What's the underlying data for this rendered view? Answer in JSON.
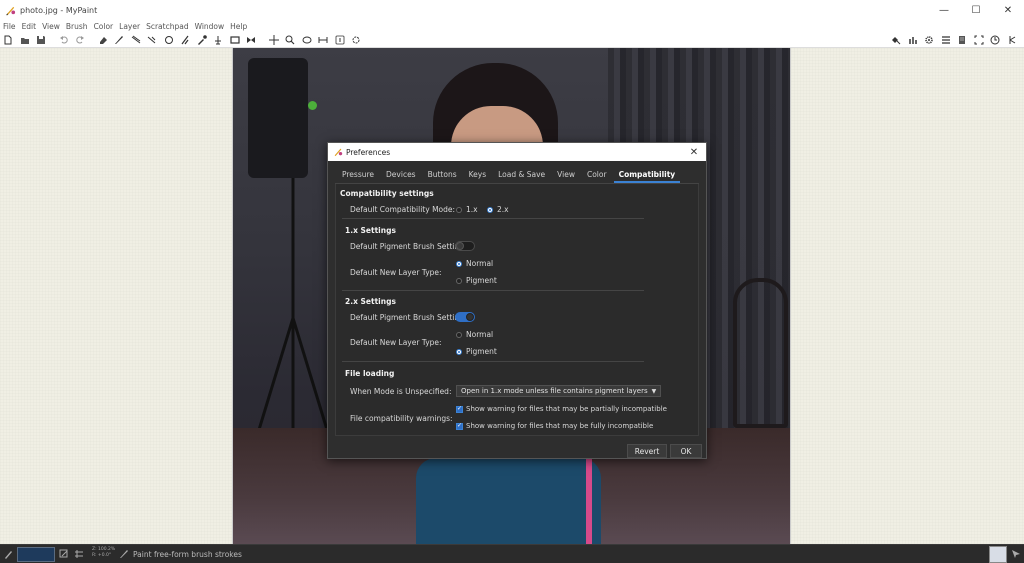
{
  "window": {
    "title": "photo.jpg - MyPaint",
    "minimize": "—",
    "maximize": "☐",
    "close": "✕"
  },
  "menu": [
    "File",
    "Edit",
    "View",
    "Brush",
    "Color",
    "Layer",
    "Scratchpad",
    "Window",
    "Help"
  ],
  "toolbar": {
    "left_icons": [
      "new-document-icon",
      "open-file-icon",
      "save-icon",
      "undo-icon",
      "redo-icon",
      "eraser-icon",
      "freehand-brush-icon",
      "inking-icon",
      "line-icon",
      "ellipse-icon",
      "fill-icon",
      "color-picker-icon",
      "layer-move-icon",
      "frame-icon",
      "symmetry-icon",
      "pan-icon",
      "zoom-icon",
      "rotate-icon",
      "flip-icon",
      "reset-zoom-icon",
      "fit-view-icon"
    ],
    "right_icons": [
      "brush-settings-icon",
      "color-wheel-icon",
      "settings-gear-icon",
      "menu-icon",
      "scratchpad-icon",
      "fullscreen-icon",
      "history-icon",
      "more-icon"
    ]
  },
  "dialog": {
    "title": "Preferences",
    "close": "✕",
    "tabs": [
      "Pressure",
      "Devices",
      "Buttons",
      "Keys",
      "Load & Save",
      "View",
      "Color",
      "Compatibility"
    ],
    "active_tab": "Compatibility",
    "compat_header": "Compatibility settings",
    "default_mode_label": "Default Compatibility Mode:",
    "mode_options": [
      {
        "label": "1.x",
        "selected": false
      },
      {
        "label": "2.x",
        "selected": true
      }
    ],
    "v1": {
      "header": "1.x Settings",
      "pigment_label": "Default Pigment Brush Setting:",
      "pigment_on": false,
      "layer_label": "Default New Layer Type:",
      "layer_options": [
        {
          "label": "Normal",
          "selected": true
        },
        {
          "label": "Pigment",
          "selected": false
        }
      ]
    },
    "v2": {
      "header": "2.x Settings",
      "pigment_label": "Default Pigment Brush Setting:",
      "pigment_on": true,
      "layer_label": "Default New Layer Type:",
      "layer_options": [
        {
          "label": "Normal",
          "selected": false
        },
        {
          "label": "Pigment",
          "selected": true
        }
      ]
    },
    "file_loading": {
      "header": "File loading",
      "unspecified_label": "When Mode is Unspecified:",
      "unspecified_value": "Open in 1.x mode unless file contains pigment layers",
      "warnings_label": "File compatibility warnings:",
      "warn_partial": "Show warning for files that may be partially incompatible",
      "warn_full": "Show warning for files that may be fully incompatible"
    },
    "revert": "Revert",
    "ok": "OK"
  },
  "statusbar": {
    "zoom_line1": "Z: 100.2%",
    "zoom_line2": "R: +0.0°",
    "message": "Paint free-form brush strokes",
    "color_hex": "#1e3a5c"
  },
  "colors": {
    "accent": "#3b82d4",
    "dialog_bg": "#2e2e2e",
    "paper": "#f0efe4"
  }
}
